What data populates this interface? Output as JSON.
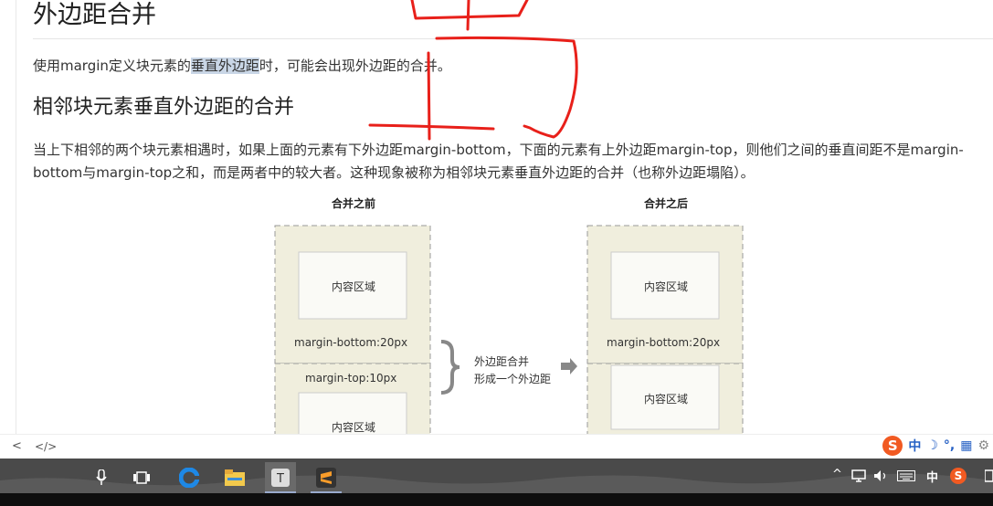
{
  "article": {
    "h1": "外边距合并",
    "p1_pre": "使用margin定义块元素的",
    "p1_hl": "垂直外边距",
    "p1_post": "时，可能会出现外边距的合并。",
    "h2": "相邻块元素垂直外边距的合并",
    "p2": "当上下相邻的两个块元素相遇时，如果上面的元素有下外边距margin-bottom，下面的元素有上外边距margin-top，则他们之间的垂直间距不是margin-bottom与margin-top之和，而是两者中的较大者。这种现象被称为相邻块元素垂直外边距的合并（也称外边距塌陷）。"
  },
  "figure": {
    "before_title": "合并之前",
    "after_title": "合并之后",
    "content_label": "内容区域",
    "margin_bottom_label": "margin-bottom:20px",
    "margin_top_label": "margin-top:10px",
    "brace_text_1": "外边距合并",
    "brace_text_2": "形成一个外边距"
  },
  "code_bar": {
    "prev": "<",
    "code": "</>"
  },
  "ime": {
    "logo": "S",
    "items": [
      "中",
      "☽",
      "°,",
      "▦",
      "⚙"
    ]
  },
  "tray": {
    "chevron": "^",
    "lang": "中",
    "s_logo": "S"
  },
  "colors": {
    "annotation": "#e8201a",
    "box_fill": "#f0eedd",
    "box_border": "#999999",
    "taskbar": "#4a4a4a"
  }
}
